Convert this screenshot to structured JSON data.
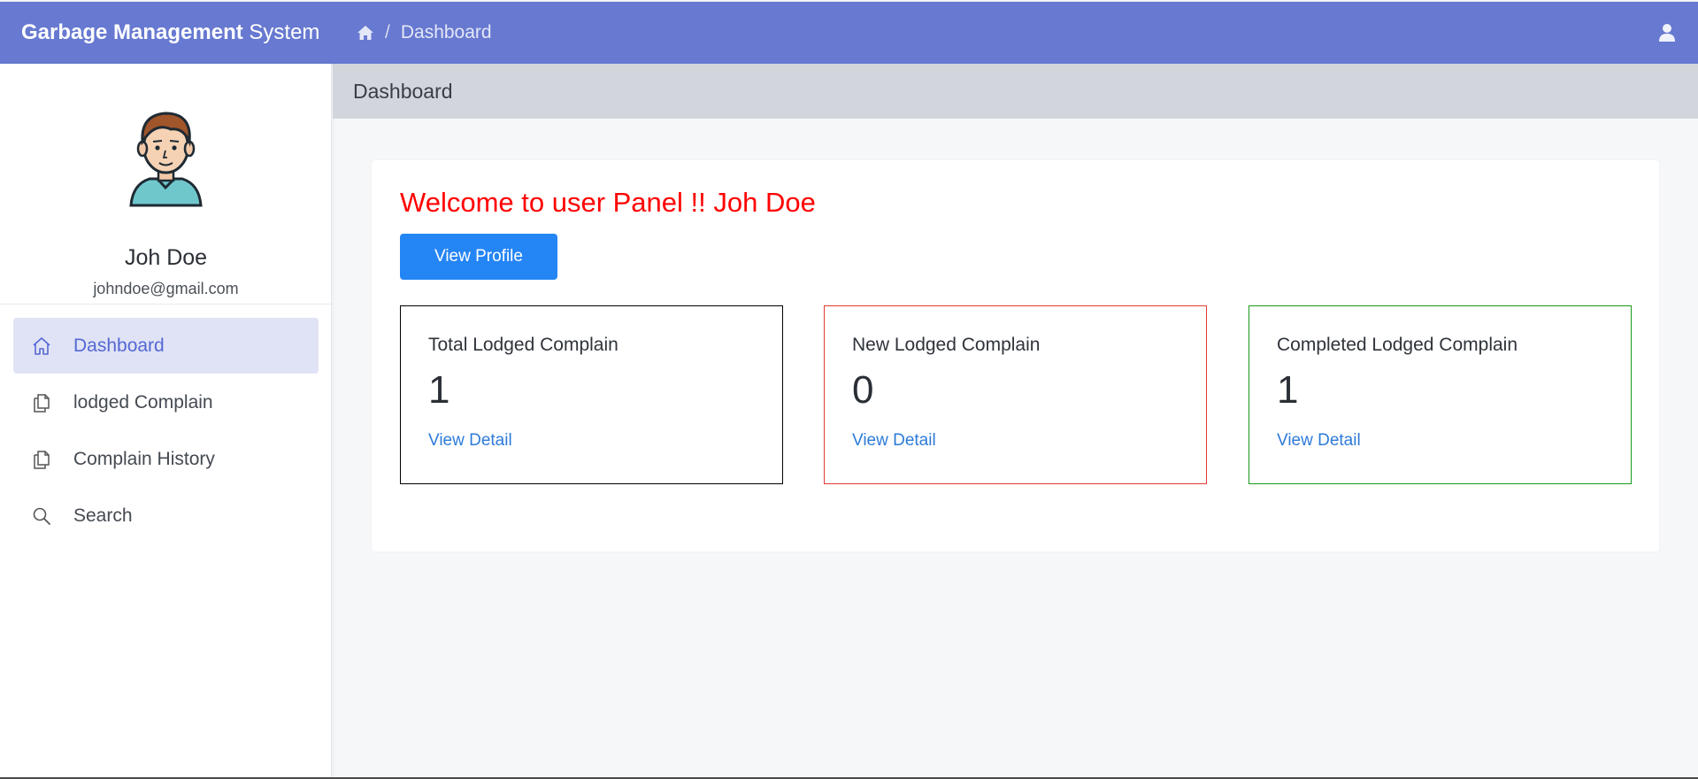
{
  "header": {
    "brand_bold": "Garbage Management",
    "brand_light": "System",
    "breadcrumb_sep": "/",
    "breadcrumb_current": "Dashboard",
    "bg_color": "#6779d0"
  },
  "sidebar": {
    "user_name": "Joh Doe",
    "user_email": "johndoe@gmail.com",
    "items": [
      {
        "label": "Dashboard",
        "icon": "home-icon",
        "active": true
      },
      {
        "label": "lodged Complain",
        "icon": "documents-icon",
        "active": false
      },
      {
        "label": "Complain History",
        "icon": "documents-icon",
        "active": false
      },
      {
        "label": "Search",
        "icon": "search-icon",
        "active": false
      }
    ]
  },
  "page": {
    "title": "Dashboard"
  },
  "main": {
    "welcome": "Welcome to user Panel !! Joh Doe",
    "view_profile": "View Profile",
    "cards": [
      {
        "title": "Total Lodged Complain",
        "value": "1",
        "link": "View Detail",
        "border": "#000000"
      },
      {
        "title": "New Lodged Complain",
        "value": "0",
        "link": "View Detail",
        "border": "#e53935"
      },
      {
        "title": "Completed Lodged Complain",
        "value": "1",
        "link": "View Detail",
        "border": "#1a9a1a"
      }
    ]
  }
}
